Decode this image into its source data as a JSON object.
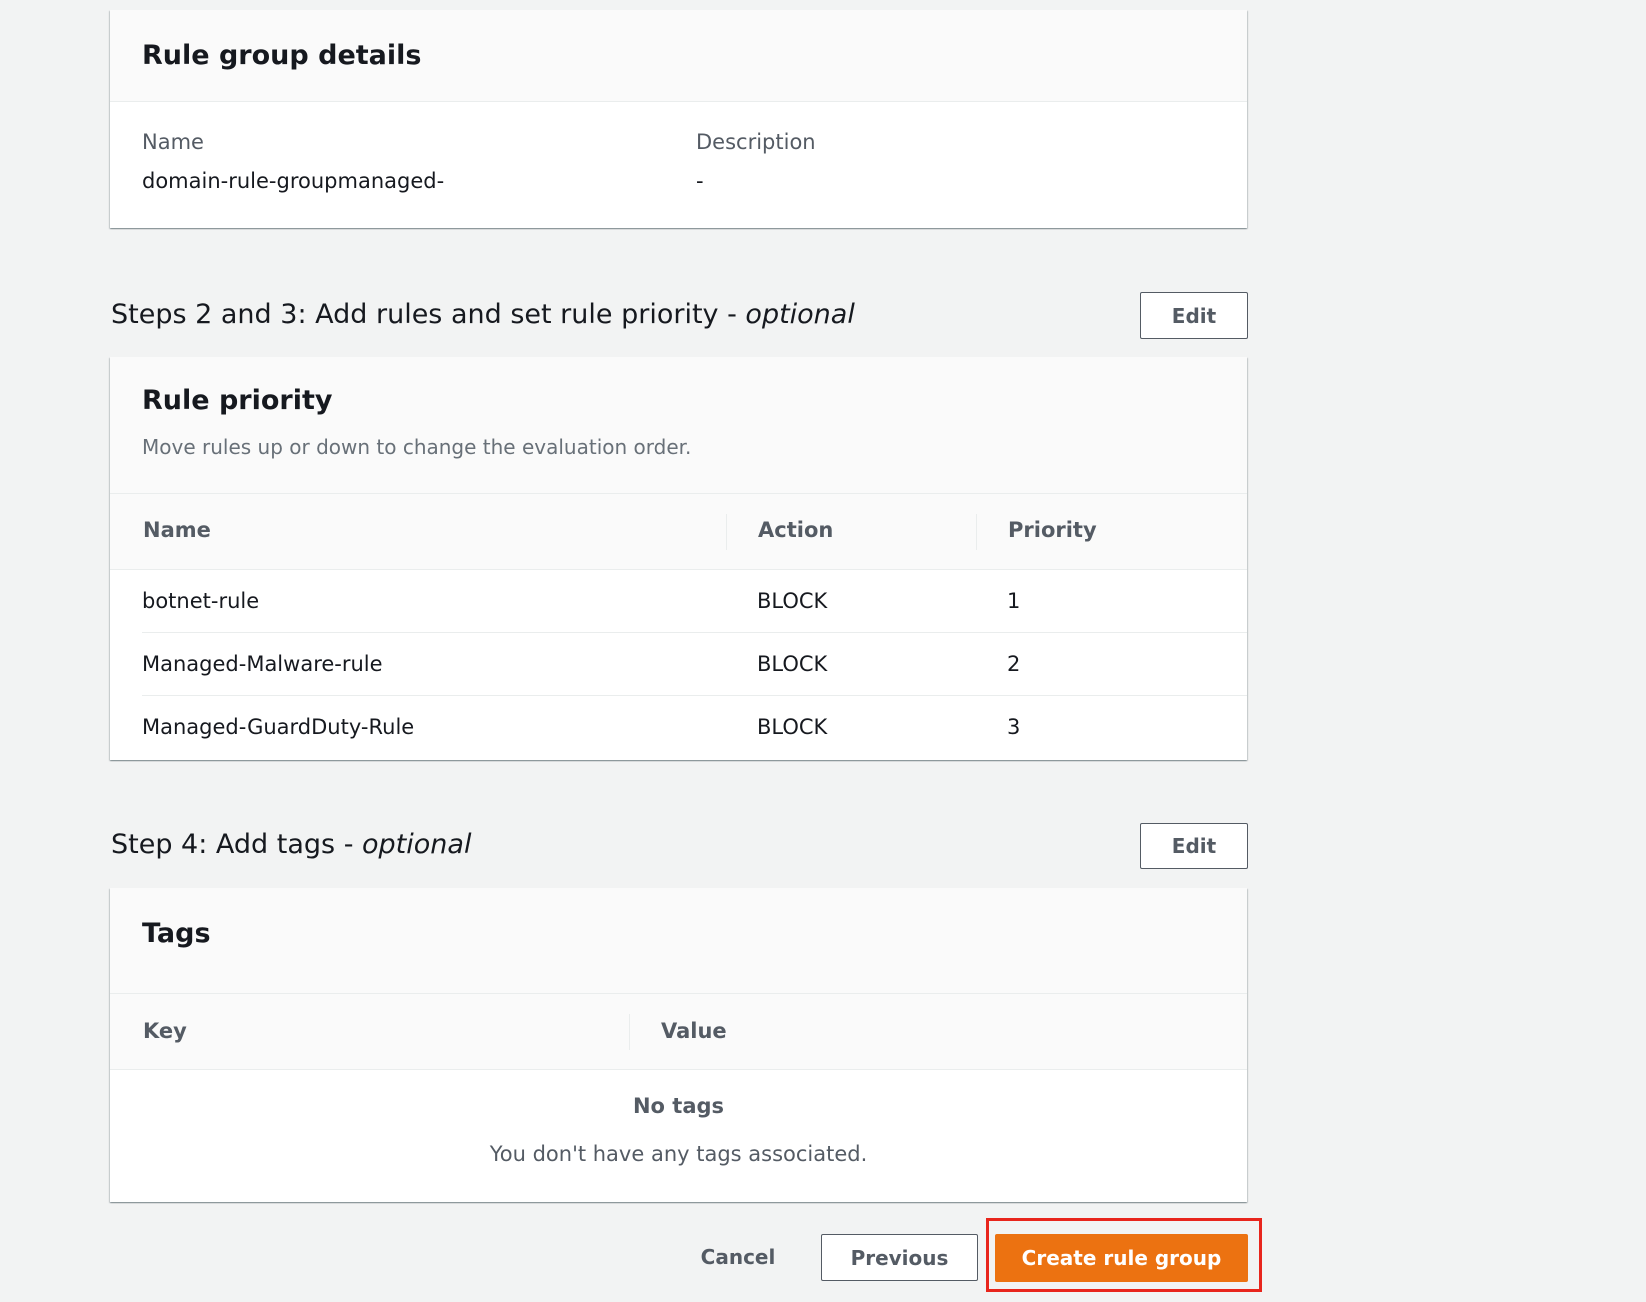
{
  "rule_group_details": {
    "title": "Rule group details",
    "name_label": "Name",
    "name_value": "domain-rule-groupmanaged-",
    "description_label": "Description",
    "description_value": "-"
  },
  "steps_2_3": {
    "title_main": "Steps 2 and 3: Add rules and set rule priority - ",
    "title_optional": "optional",
    "edit_label": "Edit"
  },
  "rule_priority": {
    "title": "Rule priority",
    "description": "Move rules up or down to change the evaluation order.",
    "columns": [
      "Name",
      "Action",
      "Priority"
    ],
    "rows": [
      {
        "name": "botnet-rule",
        "action": "BLOCK",
        "priority": "1"
      },
      {
        "name": "Managed-Malware-rule",
        "action": "BLOCK",
        "priority": "2"
      },
      {
        "name": "Managed-GuardDuty-Rule",
        "action": "BLOCK",
        "priority": "3"
      }
    ]
  },
  "step_4": {
    "title_main": "Step 4: Add tags - ",
    "title_optional": "optional",
    "edit_label": "Edit"
  },
  "tags": {
    "title": "Tags",
    "columns": [
      "Key",
      "Value"
    ],
    "empty_title": "No tags",
    "empty_message": "You don't have any tags associated."
  },
  "footer": {
    "cancel_label": "Cancel",
    "previous_label": "Previous",
    "create_label": "Create rule group"
  },
  "colors": {
    "primary_button": "#ec7211",
    "highlight_outline": "#e8251c",
    "background": "#f2f3f3"
  }
}
